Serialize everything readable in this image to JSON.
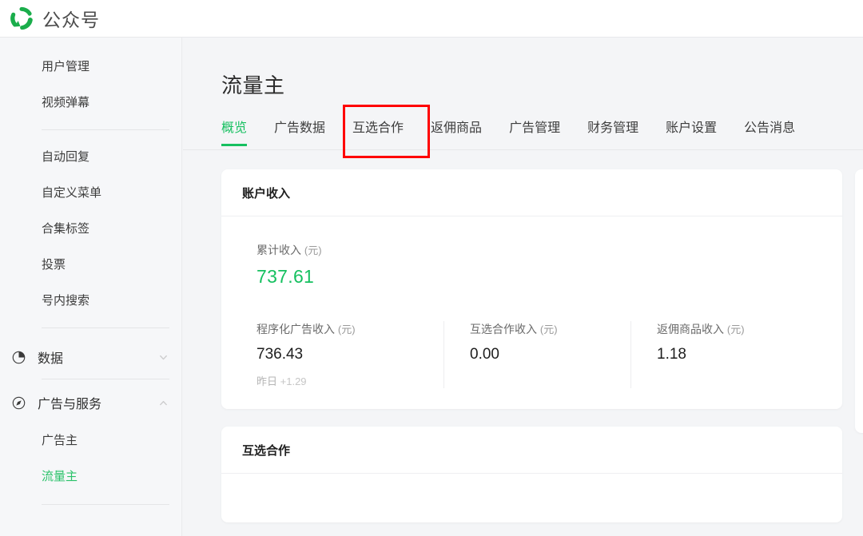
{
  "header": {
    "brand": "公众号",
    "logo_icon": "wechat-official-swirl-logo"
  },
  "colors": {
    "accent_green": "#16c060",
    "highlight_red": "#ff0000",
    "sidebar_bg": "#f6f7f9",
    "page_bg": "#f4f5f7"
  },
  "sidebar": {
    "top_items": [
      {
        "label": "用户管理"
      },
      {
        "label": "视频弹幕"
      }
    ],
    "mid_items": [
      {
        "label": "自动回复"
      },
      {
        "label": "自定义菜单"
      },
      {
        "label": "合集标签"
      },
      {
        "label": "投票"
      },
      {
        "label": "号内搜索"
      }
    ],
    "groups": [
      {
        "label": "数据",
        "icon": "pie-chart-icon",
        "chevron": "chevron-down-icon",
        "expanded": false,
        "children": []
      },
      {
        "label": "广告与服务",
        "icon": "compass-icon",
        "chevron": "chevron-up-icon",
        "expanded": true,
        "children": [
          {
            "label": "广告主",
            "active": false
          },
          {
            "label": "流量主",
            "active": true
          }
        ]
      }
    ]
  },
  "main": {
    "page_title": "流量主",
    "tabs": [
      {
        "label": "概览",
        "active": true,
        "highlighted": false
      },
      {
        "label": "广告数据",
        "active": false,
        "highlighted": false
      },
      {
        "label": "互选合作",
        "active": false,
        "highlighted": true
      },
      {
        "label": "返佣商品",
        "active": false,
        "highlighted": false
      },
      {
        "label": "广告管理",
        "active": false,
        "highlighted": false
      },
      {
        "label": "财务管理",
        "active": false,
        "highlighted": false
      },
      {
        "label": "账户设置",
        "active": false,
        "highlighted": false
      },
      {
        "label": "公告消息",
        "active": false,
        "highlighted": false
      }
    ],
    "income_card": {
      "title": "账户收入",
      "total": {
        "label": "累计收入",
        "unit": "(元)",
        "value": "737.61"
      },
      "breakdown": [
        {
          "label": "程序化广告收入",
          "unit": "(元)",
          "value": "736.43",
          "sub_label": "昨日",
          "sub_delta": "+1.29"
        },
        {
          "label": "互选合作收入",
          "unit": "(元)",
          "value": "0.00",
          "sub_label": "",
          "sub_delta": ""
        },
        {
          "label": "返佣商品收入",
          "unit": "(元)",
          "value": "1.18",
          "sub_label": "",
          "sub_delta": ""
        }
      ]
    },
    "cooperation_card": {
      "title": "互选合作"
    }
  }
}
